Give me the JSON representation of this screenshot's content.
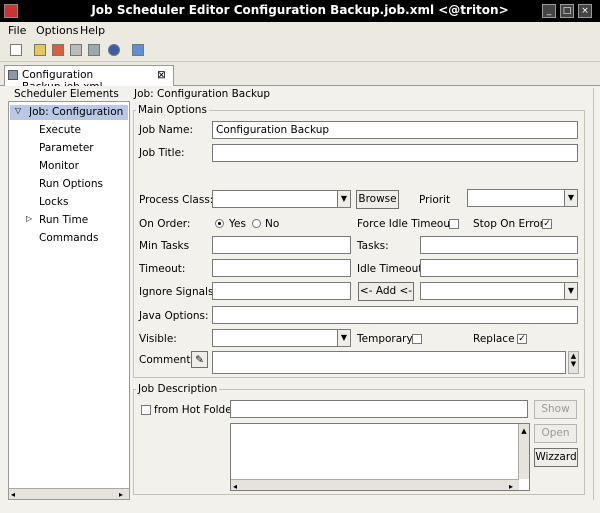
{
  "window": {
    "title": "Job Scheduler Editor Configuration Backup.job.xml  <@triton>"
  },
  "menu": {
    "file": "File",
    "options": "Options",
    "help": "Help"
  },
  "tab": {
    "label": "Configuration Backup.job.xml",
    "close": "⊠"
  },
  "sidebar": {
    "title": "Scheduler Elements",
    "items": [
      {
        "label": "Job: Configuration Ba"
      },
      {
        "label": "Execute"
      },
      {
        "label": "Parameter"
      },
      {
        "label": "Monitor"
      },
      {
        "label": "Run Options"
      },
      {
        "label": "Locks"
      },
      {
        "label": "Run Time"
      },
      {
        "label": "Commands"
      }
    ]
  },
  "panel": {
    "title": "Job: Configuration Backup"
  },
  "main_options": {
    "section": "Main Options",
    "job_name_label": "Job Name:",
    "job_name_value": "Configuration Backup",
    "job_title_label": "Job Title:",
    "job_title_value": "",
    "process_class_label": "Process Class:",
    "browse": "Browse",
    "priority_label": "Priorit",
    "on_order_label": "On Order:",
    "yes": "Yes",
    "no": "No",
    "force_idle_label": "Force Idle Timeout",
    "stop_on_error_label": "Stop On Error",
    "min_tasks_label": "Min Tasks",
    "tasks_label": "Tasks:",
    "timeout_label": "Timeout:",
    "idle_timeout_label": "Idle Timeout:",
    "ignore_signals_label": "Ignore Signals:",
    "add_button": "<- Add <-",
    "java_options_label": "Java Options:",
    "visible_label": "Visible:",
    "temporary_label": "Temporary",
    "replace_label": "Replace",
    "comment_label": "Comment:"
  },
  "job_description": {
    "section": "Job Description",
    "hot_folder_label": "from Hot Folder",
    "show": "Show",
    "open": "Open",
    "wizzard": "Wizzard"
  }
}
